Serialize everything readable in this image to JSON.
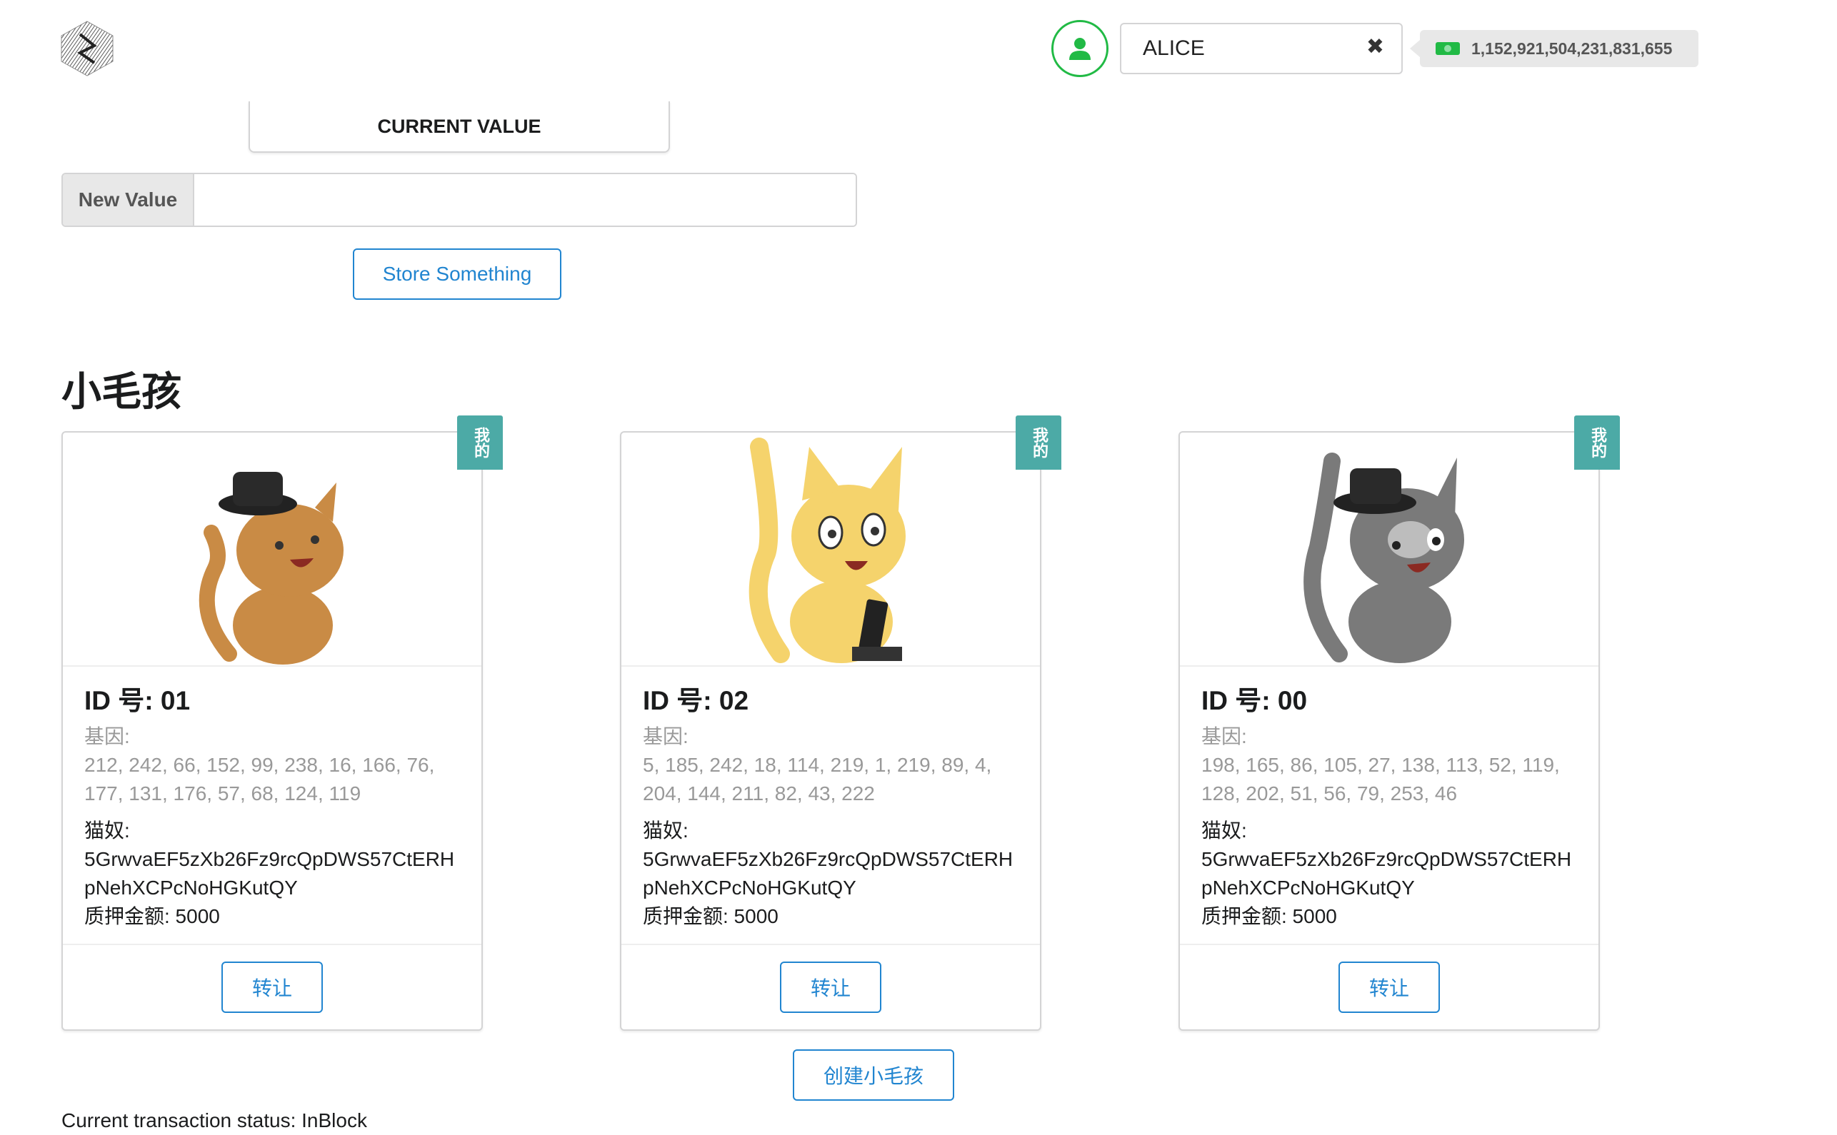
{
  "header": {
    "account_name": "ALICE",
    "balance": "1,152,921,504,231,831,655",
    "icons": [
      "logo-icon",
      "user-icon",
      "close-icon",
      "cash-icon"
    ]
  },
  "storage": {
    "current_value_label": "CURRENT VALUE",
    "new_value_label": "New Value",
    "new_value_input": "",
    "store_button": "Store Something"
  },
  "kitties": {
    "title": "小毛孩",
    "mine_badge": "我的",
    "items": [
      {
        "id_label": "ID 号: 01",
        "genes_label": "基因:",
        "genes": "212, 242, 66, 152, 99, 238, 16, 166, 76, 177, 131, 176, 57, 68, 124, 119",
        "owner_label": "猫奴:",
        "owner": "5GrwvaEF5zXb26Fz9rcQpDWS57CtERHpNehXCPcNoHGKutQY",
        "deposit": "质押金额: 5000",
        "transfer_button": "转让",
        "fur_color": "#c98b45"
      },
      {
        "id_label": "ID 号: 02",
        "genes_label": "基因:",
        "genes": "5, 185, 242, 18, 114, 219, 1, 219, 89, 4, 204, 144, 211, 82, 43, 222",
        "owner_label": "猫奴:",
        "owner": "5GrwvaEF5zXb26Fz9rcQpDWS57CtERHpNehXCPcNoHGKutQY",
        "deposit": "质押金额: 5000",
        "transfer_button": "转让",
        "fur_color": "#f5d36c"
      },
      {
        "id_label": "ID 号: 00",
        "genes_label": "基因:",
        "genes": "198, 165, 86, 105, 27, 138, 113, 52, 119, 128, 202, 51, 56, 79, 253, 46",
        "owner_label": "猫奴:",
        "owner": "5GrwvaEF5zXb26Fz9rcQpDWS57CtERHpNehXCPcNoHGKutQY",
        "deposit": "质押金额: 5000",
        "transfer_button": "转让",
        "fur_color": "#7a7a7a"
      }
    ],
    "create_button": "创建小毛孩"
  },
  "status": {
    "text": "Current transaction status: InBlock"
  },
  "colors": {
    "accent": "#2185d0",
    "badge": "#4caaa6",
    "online": "#21ba45"
  }
}
